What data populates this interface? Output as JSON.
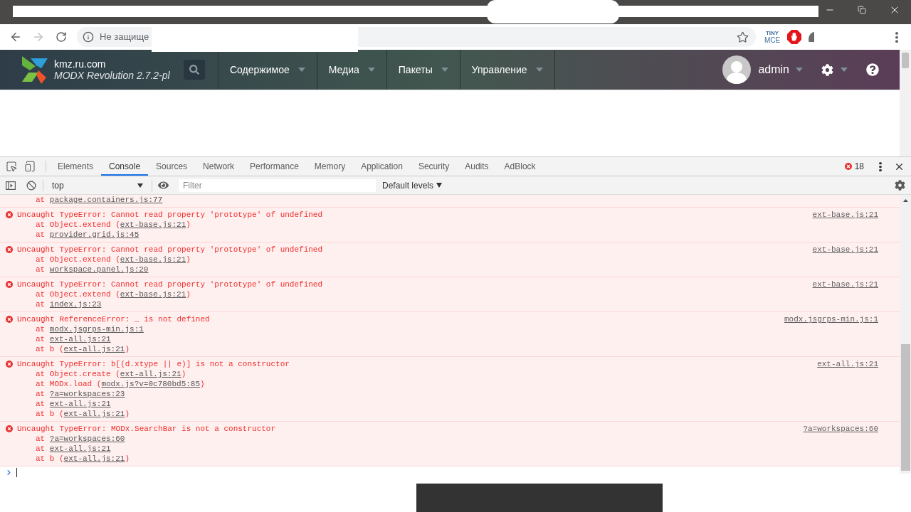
{
  "browser": {
    "security_text": "Не защище",
    "extension_lines": [
      "TINY",
      "MCE"
    ]
  },
  "site_header": {
    "site_name": "kmz.ru.com",
    "version": "MODX Revolution 2.7.2-pl",
    "menu": [
      {
        "label": "Содержимое"
      },
      {
        "label": "Медиа"
      },
      {
        "label": "Пакеты"
      },
      {
        "label": "Управление"
      }
    ],
    "user": "admin"
  },
  "devtools": {
    "tabs": [
      {
        "label": "Elements",
        "selected": false
      },
      {
        "label": "Console",
        "selected": true
      },
      {
        "label": "Sources",
        "selected": false
      },
      {
        "label": "Network",
        "selected": false
      },
      {
        "label": "Performance",
        "selected": false
      },
      {
        "label": "Memory",
        "selected": false
      },
      {
        "label": "Application",
        "selected": false
      },
      {
        "label": "Security",
        "selected": false
      },
      {
        "label": "Audits",
        "selected": false
      },
      {
        "label": "AdBlock",
        "selected": false
      }
    ],
    "error_count": "18",
    "context": "top",
    "filter_placeholder": "Filter",
    "levels": "Default levels"
  },
  "console": {
    "messages": [
      {
        "kind": "continuation",
        "stack": [
          {
            "before": "at ",
            "link": "package.containers.js:77"
          }
        ]
      },
      {
        "kind": "error",
        "text": "Uncaught TypeError: Cannot read property 'prototype' of undefined",
        "source": "ext-base.js:21",
        "stack": [
          {
            "before": "at Object.extend (",
            "link": "ext-base.js:21",
            "after": ")"
          },
          {
            "before": "at ",
            "link": "provider.grid.js:45"
          }
        ]
      },
      {
        "kind": "error",
        "text": "Uncaught TypeError: Cannot read property 'prototype' of undefined",
        "source": "ext-base.js:21",
        "stack": [
          {
            "before": "at Object.extend (",
            "link": "ext-base.js:21",
            "after": ")"
          },
          {
            "before": "at ",
            "link": "workspace.panel.js:20"
          }
        ]
      },
      {
        "kind": "error",
        "text": "Uncaught TypeError: Cannot read property 'prototype' of undefined",
        "source": "ext-base.js:21",
        "stack": [
          {
            "before": "at Object.extend (",
            "link": "ext-base.js:21",
            "after": ")"
          },
          {
            "before": "at ",
            "link": "index.js:23"
          }
        ]
      },
      {
        "kind": "error",
        "text": "Uncaught ReferenceError: _ is not defined",
        "source": "modx.jsgrps-min.js:1",
        "stack": [
          {
            "before": "at ",
            "link": "modx.jsgrps-min.js:1"
          },
          {
            "before": "at ",
            "link": "ext-all.js:21"
          },
          {
            "before": "at b (",
            "link": "ext-all.js:21",
            "after": ")"
          }
        ]
      },
      {
        "kind": "error",
        "text": "Uncaught TypeError: b[(d.xtype || e)] is not a constructor",
        "source": "ext-all.js:21",
        "stack": [
          {
            "before": "at Object.create (",
            "link": "ext-all.js:21",
            "after": ")"
          },
          {
            "before": "at MODx.load (",
            "link": "modx.js?v=0c780bd5:85",
            "after": ")"
          },
          {
            "before": "at ",
            "link": "?a=workspaces:23"
          },
          {
            "before": "at ",
            "link": "ext-all.js:21"
          },
          {
            "before": "at b (",
            "link": "ext-all.js:21",
            "after": ")"
          }
        ]
      },
      {
        "kind": "error",
        "text": "Uncaught TypeError: MODx.SearchBar is not a constructor",
        "source": "?a=workspaces:60",
        "stack": [
          {
            "before": "at ",
            "link": "?a=workspaces:60"
          },
          {
            "before": "at ",
            "link": "ext-all.js:21"
          },
          {
            "before": "at b (",
            "link": "ext-all.js:21",
            "after": ")"
          }
        ]
      }
    ]
  }
}
